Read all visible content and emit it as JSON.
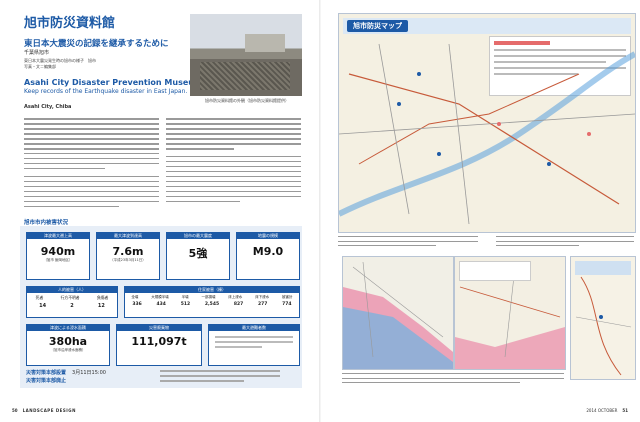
{
  "left_page": {
    "title_jp": "旭市防災資料館",
    "subtitle_jp": "東日本大震災の記録を継承するために",
    "location_jp": "千葉県旭市",
    "credit1": "東日本大震災発生時の旭市の様子　旭市",
    "credit2": "写真・文＝編集部",
    "title_en": "Asahi City Disaster Prevention Museum",
    "subtitle_en": "Keep records of the Earthquake disaster in East Japan.",
    "location_en": "Asahi City, Chiba",
    "photo_caption": "旭市防災資料館の外観（旭市防災資料館提供）",
    "section_header": "旭市市内被害状況",
    "stats_row1": [
      {
        "head": "津波最大遡上高",
        "value": "940m",
        "note": "（旭市 飯岡地区）"
      },
      {
        "head": "最大津波到達高",
        "value": "7.6m",
        "note": "（平成23年3月11日）"
      },
      {
        "head": "旭市の最大震度",
        "value": "5強",
        "note": ""
      },
      {
        "head": "地震の規模",
        "value": "M9.0",
        "note": ""
      }
    ],
    "casualties_label": "人的被害（人）",
    "casualties_cols": [
      "死者",
      "行方不明者",
      "負傷者"
    ],
    "casualties_vals": [
      "14",
      "2",
      "12"
    ],
    "housing_label": "住家被害（棟）",
    "housing_cols": [
      "全壊",
      "大規模半壊",
      "半壊",
      "一部損壊",
      "床上浸水",
      "床下浸水",
      "被害計"
    ],
    "housing_vals": [
      "336",
      "434",
      "512",
      "2,545",
      "827",
      "277",
      "774"
    ],
    "stats_row3": [
      {
        "head": "津波による浸水面積",
        "value": "380ha",
        "note": "（旭市沿岸浸水面積）"
      },
      {
        "head": "災害廃棄物",
        "value": "111,097t",
        "note": ""
      },
      {
        "head": "最大避難者数",
        "value": "",
        "note": ""
      }
    ],
    "facility_info": [
      {
        "label": "災害対策本部設置",
        "value": "3月11日15:00"
      },
      {
        "label": "災害対策本部廃止",
        "value": ""
      }
    ],
    "folio": "50",
    "magazine": "LANDSCAPE DESIGN"
  },
  "right_page": {
    "map_title": "旭市防災マップ",
    "folio": "51",
    "issue": "2014 OCTOBER"
  }
}
